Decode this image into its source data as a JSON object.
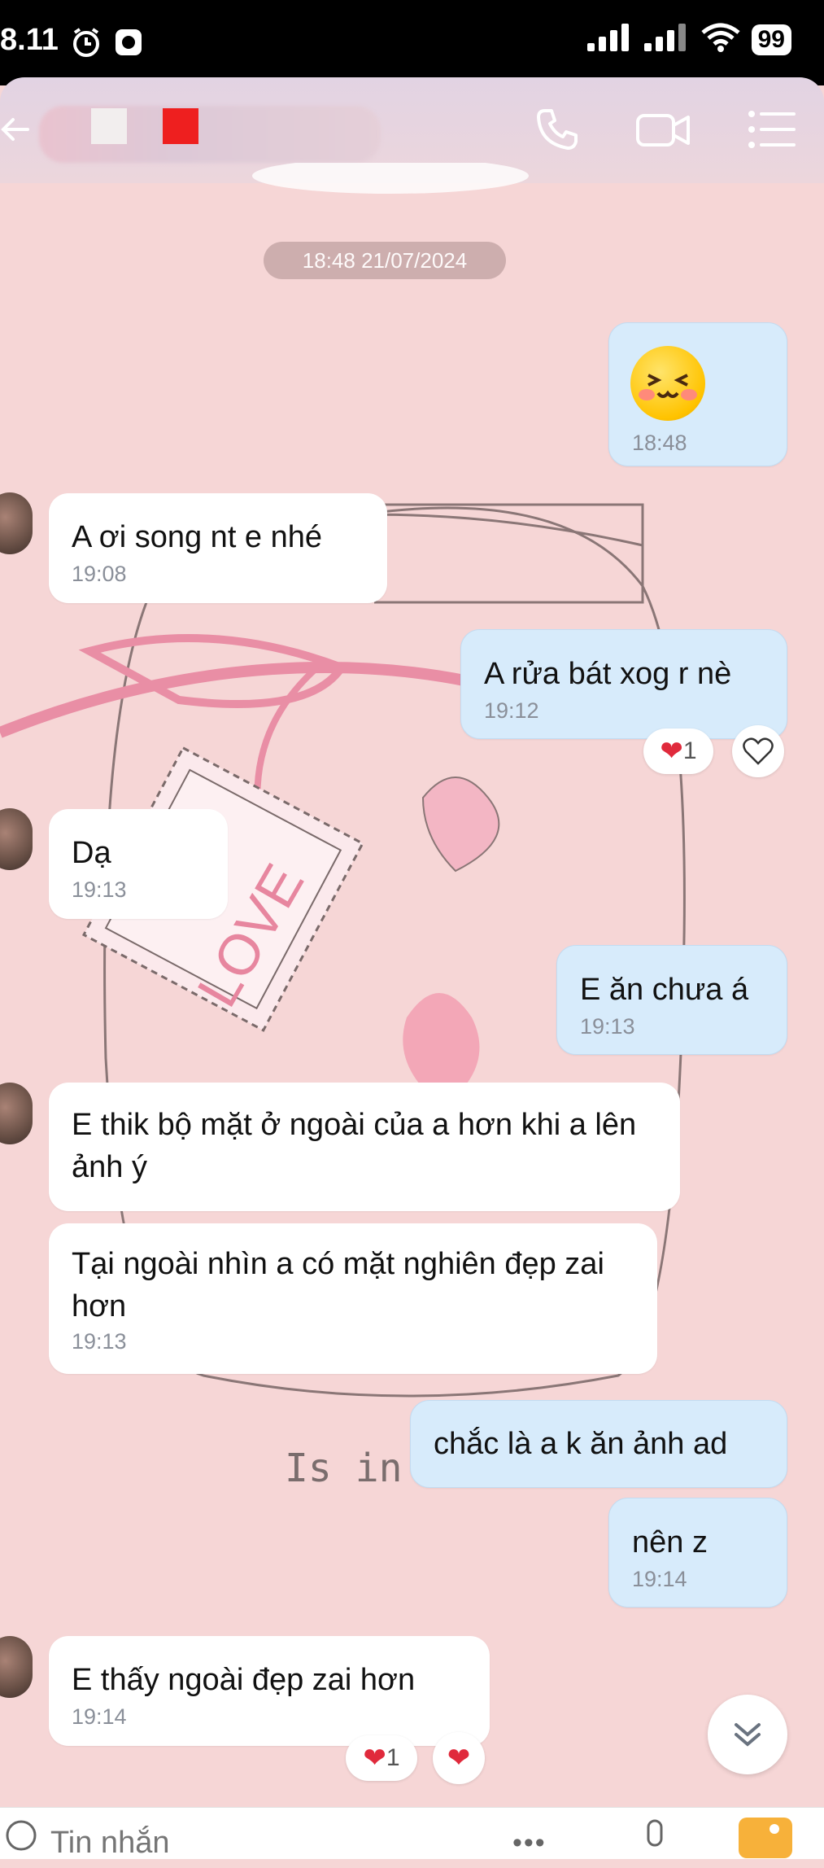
{
  "status_bar": {
    "time": "8.11",
    "battery": "99",
    "icons": [
      "alarm-icon",
      "app-icon",
      "signal-icon",
      "signal-icon",
      "wifi-icon"
    ]
  },
  "header": {
    "icons": [
      "back-arrow-icon",
      "phone-icon",
      "video-call-icon",
      "menu-icon"
    ]
  },
  "chat": {
    "date_separator": "18:48 21/07/2024",
    "messages": [
      {
        "id": "m1",
        "direction": "out",
        "text": "😊",
        "time": "18:48"
      },
      {
        "id": "m2",
        "direction": "in",
        "text": "A ơi song nt e nhé",
        "time": "19:08"
      },
      {
        "id": "m3",
        "direction": "out",
        "text": "A rửa bát xog r nè",
        "time": "19:12",
        "reaction_count": "1"
      },
      {
        "id": "m4",
        "direction": "in",
        "text": "Dạ",
        "time": "19:13"
      },
      {
        "id": "m5",
        "direction": "out",
        "text": "E ăn chưa á",
        "time": "19:13"
      },
      {
        "id": "m6",
        "direction": "in",
        "text": "E thik bộ mặt ở ngoài của a hơn khi a lên ảnh ý",
        "time": ""
      },
      {
        "id": "m7",
        "direction": "in",
        "text": "Tại ngoài nhìn a có mặt nghiên đẹp zai hơn",
        "time": "19:13"
      },
      {
        "id": "m8",
        "direction": "out",
        "text": "chắc là a k ăn ảnh ad",
        "time": ""
      },
      {
        "id": "m9",
        "direction": "out",
        "text": "nên z",
        "time": "19:14"
      },
      {
        "id": "m10",
        "direction": "in",
        "text": "E thấy ngoài đẹp zai hơn",
        "time": "19:14",
        "reaction_count": "1"
      }
    ],
    "background_text": "Is in season..."
  },
  "composer": {
    "placeholder": "Tin nhắn"
  },
  "colors": {
    "chat_background": "#f6d6d6",
    "outgoing_bubble": "#d7ebfb",
    "incoming_bubble": "#ffffff",
    "heart": "#e02a3c"
  }
}
